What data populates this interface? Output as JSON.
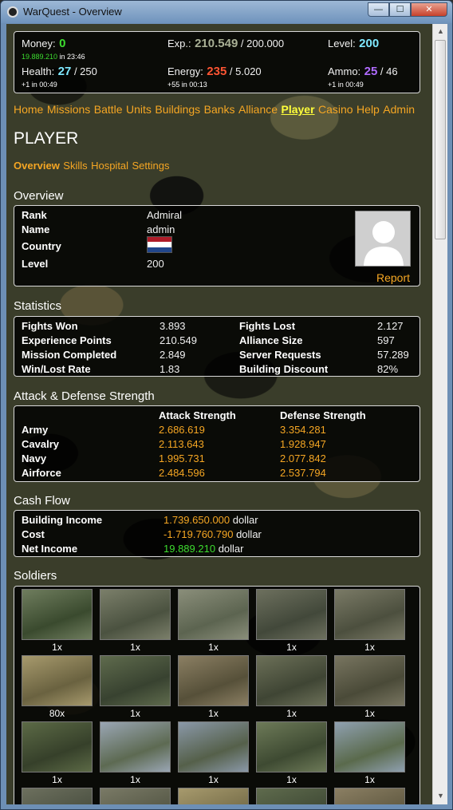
{
  "window": {
    "title": "WarQuest - Overview",
    "minimize": "—",
    "maximize": "☐",
    "close": "✕"
  },
  "stats": {
    "money_label": "Money:",
    "money_value": "0",
    "money_sub": "19.889.210",
    "money_sub_suffix": " in 23:46",
    "exp_label": "Exp.:",
    "exp_value": "210.549",
    "exp_max": " / 200.000",
    "level_label": "Level:",
    "level_value": "200",
    "health_label": "Health:",
    "health_value": "27",
    "health_max": " / 250",
    "health_sub": "+1 in 00:49",
    "energy_label": "Energy:",
    "energy_value": "235",
    "energy_max": " / 5.020",
    "energy_sub": "+55 in 00:13",
    "ammo_label": "Ammo:",
    "ammo_value": "25",
    "ammo_max": " / 46",
    "ammo_sub": "+1 in 00:49"
  },
  "nav": [
    "Home",
    "Missions",
    "Battle",
    "Units",
    "Buildings",
    "Banks",
    "Alliance",
    "Player",
    "Casino",
    "Help",
    "Admin"
  ],
  "nav_active": "Player",
  "page_title": "PLAYER",
  "subnav": [
    "Overview",
    "Skills",
    "Hospital",
    "Settings"
  ],
  "overview": {
    "title": "Overview",
    "rows": [
      {
        "label": "Rank",
        "value": "Admiral"
      },
      {
        "label": "Name",
        "value": "admin"
      },
      {
        "label": "Country",
        "value": ""
      },
      {
        "label": "Level",
        "value": "200"
      }
    ],
    "report": "Report",
    "flag_colors": [
      "#ae1c28",
      "#ffffff",
      "#21468b"
    ]
  },
  "statistics": {
    "title": "Statistics",
    "left": [
      {
        "label": "Fights Won",
        "value": "3.893"
      },
      {
        "label": "Experience Points",
        "value": "210.549"
      },
      {
        "label": "Mission Completed",
        "value": "2.849"
      },
      {
        "label": "Win/Lost Rate",
        "value": "1.83"
      }
    ],
    "right": [
      {
        "label": "Fights Lost",
        "value": "2.127"
      },
      {
        "label": "Alliance Size",
        "value": "597"
      },
      {
        "label": "Server Requests",
        "value": "57.289"
      },
      {
        "label": "Building Discount",
        "value": "82%"
      }
    ]
  },
  "strength": {
    "title": "Attack & Defense Strength",
    "col_attack": "Attack Strength",
    "col_defense": "Defense Strength",
    "rows": [
      {
        "label": "Army",
        "attack": "2.686.619",
        "defense": "3.354.281"
      },
      {
        "label": "Cavalry",
        "attack": "2.113.643",
        "defense": "1.928.947"
      },
      {
        "label": "Navy",
        "attack": "1.995.731",
        "defense": "2.077.842"
      },
      {
        "label": "Airforce",
        "attack": "2.484.596",
        "defense": "2.537.794"
      }
    ]
  },
  "cashflow": {
    "title": "Cash Flow",
    "rows": [
      {
        "label": "Building Income",
        "value": "1.739.650.000",
        "unit": " dollar"
      },
      {
        "label": "Cost",
        "value": "-1.719.760.790",
        "unit": " dollar"
      },
      {
        "label": "Net Income",
        "value": "19.889.210",
        "unit": " dollar"
      }
    ]
  },
  "soldiers": {
    "title": "Soldiers",
    "items": [
      "1x",
      "1x",
      "1x",
      "1x",
      "1x",
      "80x",
      "1x",
      "1x",
      "1x",
      "1x",
      "1x",
      "1x",
      "1x",
      "1x",
      "1x"
    ]
  },
  "colors": {
    "accent": "#f5a623",
    "active_nav": "#ffff3a",
    "positive": "#3ddc2f",
    "negative": "#ff5533",
    "level": "#7fe9ff",
    "ammo": "#b06bff"
  }
}
